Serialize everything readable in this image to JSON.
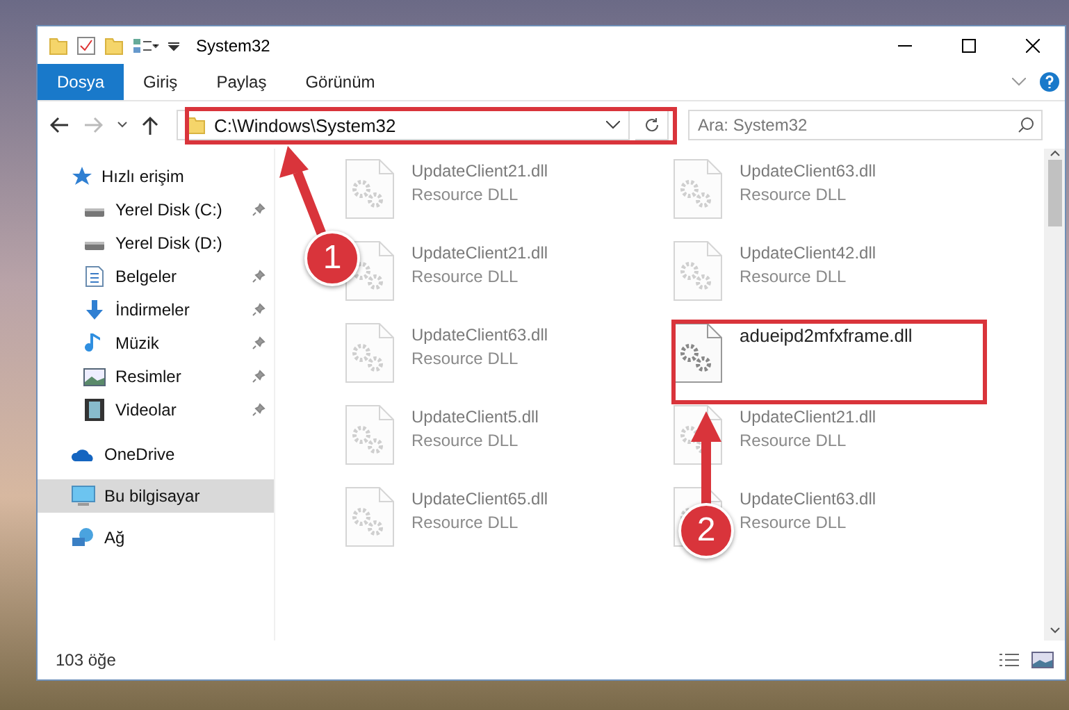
{
  "window": {
    "title": "System32"
  },
  "ribbon_tabs": [
    {
      "label": "Dosya",
      "selected": true
    },
    {
      "label": "Giriş",
      "selected": false
    },
    {
      "label": "Paylaş",
      "selected": false
    },
    {
      "label": "Görünüm",
      "selected": false
    }
  ],
  "address": {
    "path": "C:\\Windows\\System32"
  },
  "search": {
    "placeholder": "Ara: System32"
  },
  "sidebar": {
    "items": [
      {
        "label": "Hızlı erişim",
        "kind": "star",
        "selected": false,
        "children": [
          {
            "label": "Yerel Disk (C:)",
            "kind": "drive",
            "pinned": true,
            "selected": false
          },
          {
            "label": "Yerel Disk (D:)",
            "kind": "drive",
            "pinned": false,
            "selected": false
          },
          {
            "label": "Belgeler",
            "kind": "docs",
            "pinned": true,
            "selected": false
          },
          {
            "label": "İndirmeler",
            "kind": "download",
            "pinned": true,
            "selected": false
          },
          {
            "label": "Müzik",
            "kind": "music",
            "pinned": true,
            "selected": false
          },
          {
            "label": "Resimler",
            "kind": "pictures",
            "pinned": true,
            "selected": false
          },
          {
            "label": "Videolar",
            "kind": "videos",
            "pinned": true,
            "selected": false
          }
        ]
      },
      {
        "label": "OneDrive",
        "kind": "cloud",
        "selected": false
      },
      {
        "label": "Bu bilgisayar",
        "kind": "computer",
        "selected": true
      },
      {
        "label": "Ağ",
        "kind": "network",
        "selected": false
      }
    ]
  },
  "files": [
    {
      "name": "UpdateClient21.dll",
      "type": "Resource DLL",
      "faded": true
    },
    {
      "name": "UpdateClient63.dll",
      "type": "Resource DLL",
      "faded": true
    },
    {
      "name": "UpdateClient21.dll",
      "type": "Resource DLL",
      "faded": true
    },
    {
      "name": "UpdateClient42.dll",
      "type": "Resource DLL",
      "faded": true
    },
    {
      "name": "UpdateClient63.dll",
      "type": "Resource DLL",
      "faded": true
    },
    {
      "name": "adueipd2mfxframe.dll",
      "faded": false
    },
    {
      "name": "UpdateClient5.dll",
      "type": "Resource DLL",
      "faded": true
    },
    {
      "name": "UpdateClient21.dll",
      "type": "Resource DLL",
      "faded": true
    },
    {
      "name": "UpdateClient65.dll",
      "type": "Resource DLL",
      "faded": true
    },
    {
      "name": "UpdateClient63.dll",
      "type": "Resource DLL",
      "faded": true
    }
  ],
  "status_bar": {
    "count": "103 öğe"
  },
  "annotations": [
    {
      "number": "1"
    },
    {
      "number": "2"
    }
  ]
}
